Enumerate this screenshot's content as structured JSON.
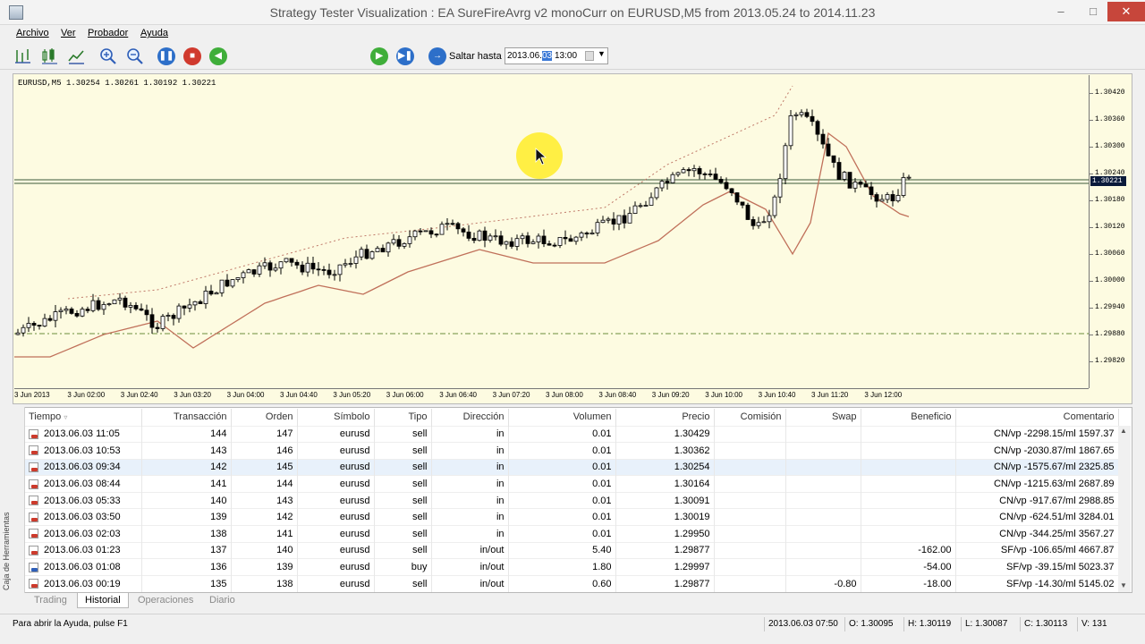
{
  "window": {
    "title": "Strategy Tester Visualization : EA SureFireAvrg v2 monoCurr on EURUSD,M5 from 2013.05.24 to 2014.11.23"
  },
  "menu": [
    "Archivo",
    "Ver",
    "Probador",
    "Ayuda"
  ],
  "toolbar": {
    "jump_label": "Saltar hasta",
    "date_value": "2013.06.",
    "date_selected": "03",
    "time_value": "13:00"
  },
  "chart": {
    "symbol_info": "EURUSD,M5  1.30254 1.30261 1.30192 1.30221",
    "current_price": "1.30221",
    "price_ticks": [
      "1.30420",
      "1.30360",
      "1.30300",
      "1.30240",
      "1.30180",
      "1.30120",
      "1.30060",
      "1.30000",
      "1.29940",
      "1.29880",
      "1.29820"
    ],
    "time_ticks": [
      "3 Jun 2013",
      "3 Jun 02:00",
      "3 Jun 02:40",
      "3 Jun 03:20",
      "3 Jun 04:00",
      "3 Jun 04:40",
      "3 Jun 05:20",
      "3 Jun 06:00",
      "3 Jun 06:40",
      "3 Jun 07:20",
      "3 Jun 08:00",
      "3 Jun 08:40",
      "3 Jun 09:20",
      "3 Jun 10:00",
      "3 Jun 10:40",
      "3 Jun 11:20",
      "3 Jun 12:00"
    ]
  },
  "table": {
    "headers": [
      "Tiempo",
      "Transacción",
      "Orden",
      "Símbolo",
      "Tipo",
      "Dirección",
      "Volumen",
      "Precio",
      "Comisión",
      "Swap",
      "Beneficio",
      "Comentario"
    ],
    "rows": [
      [
        "2013.06.03 11:05",
        "144",
        "147",
        "eurusd",
        "sell",
        "in",
        "0.01",
        "1.30429",
        "",
        "",
        "",
        "CN/vp -2298.15/ml 1597.37"
      ],
      [
        "2013.06.03 10:53",
        "143",
        "146",
        "eurusd",
        "sell",
        "in",
        "0.01",
        "1.30362",
        "",
        "",
        "",
        "CN/vp -2030.87/ml 1867.65"
      ],
      [
        "2013.06.03 09:34",
        "142",
        "145",
        "eurusd",
        "sell",
        "in",
        "0.01",
        "1.30254",
        "",
        "",
        "",
        "CN/vp -1575.67/ml 2325.85"
      ],
      [
        "2013.06.03 08:44",
        "141",
        "144",
        "eurusd",
        "sell",
        "in",
        "0.01",
        "1.30164",
        "",
        "",
        "",
        "CN/vp -1215.63/ml 2687.89"
      ],
      [
        "2013.06.03 05:33",
        "140",
        "143",
        "eurusd",
        "sell",
        "in",
        "0.01",
        "1.30091",
        "",
        "",
        "",
        "CN/vp -917.67/ml 2988.85"
      ],
      [
        "2013.06.03 03:50",
        "139",
        "142",
        "eurusd",
        "sell",
        "in",
        "0.01",
        "1.30019",
        "",
        "",
        "",
        "CN/vp -624.51/ml 3284.01"
      ],
      [
        "2013.06.03 02:03",
        "138",
        "141",
        "eurusd",
        "sell",
        "in",
        "0.01",
        "1.29950",
        "",
        "",
        "",
        "CN/vp -344.25/ml 3567.27"
      ],
      [
        "2013.06.03 01:23",
        "137",
        "140",
        "eurusd",
        "sell",
        "in/out",
        "5.40",
        "1.29877",
        "",
        "",
        "-162.00",
        "SF/vp -106.65/ml 4667.87"
      ],
      [
        "2013.06.03 01:08",
        "136",
        "139",
        "eurusd",
        "buy",
        "in/out",
        "1.80",
        "1.29997",
        "",
        "",
        "-54.00",
        "SF/vp -39.15/ml 5023.37"
      ],
      [
        "2013.06.03 00:19",
        "135",
        "138",
        "eurusd",
        "sell",
        "in/out",
        "0.60",
        "1.29877",
        "",
        "-0.80",
        "-18.00",
        "SF/vp -14.30/ml 5145.02"
      ]
    ]
  },
  "side_label": "Caja de Herramientas",
  "tabs": [
    "Trading",
    "Historial",
    "Operaciones",
    "Diario"
  ],
  "active_tab": "Historial",
  "status": {
    "help": "Para abrir la Ayuda, pulse F1",
    "datetime": "2013.06.03 07:50",
    "open": "O: 1.30095",
    "high": "H: 1.30119",
    "low": "L: 1.30087",
    "close": "C: 1.30113",
    "volume": "V: 131"
  }
}
